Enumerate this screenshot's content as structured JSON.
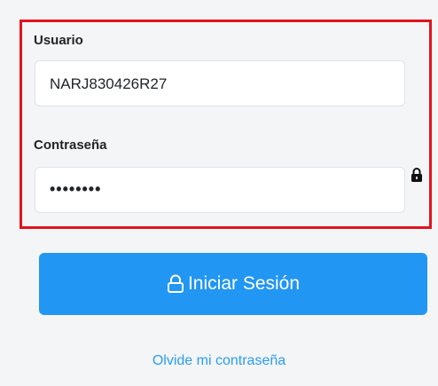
{
  "form": {
    "user_label": "Usuario",
    "user_value": "NARJ830426R27",
    "password_label": "Contraseña",
    "password_value": "••••••••"
  },
  "actions": {
    "login_label": "Iniciar Sesión",
    "forgot_label": "Olvide mi contraseña"
  },
  "icons": {
    "password_lock": "lock-icon",
    "button_lock": "lock-outline-icon"
  },
  "colors": {
    "highlight_border": "#e1141e",
    "primary_button": "#2196f3",
    "link": "#2a9df4"
  }
}
